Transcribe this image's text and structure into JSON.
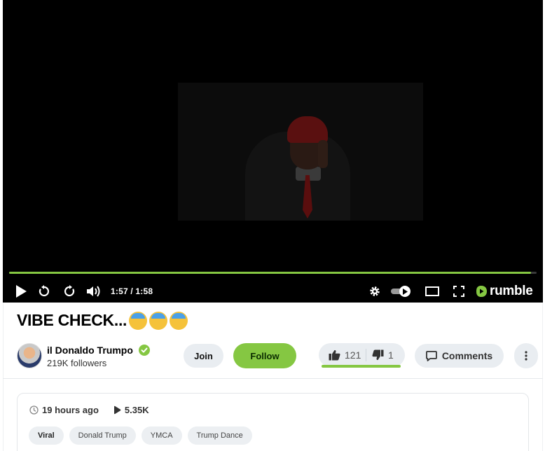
{
  "player": {
    "time_display": "1:57 / 1:58",
    "progress_fraction": 0.99,
    "logo_text": "rumble",
    "accent_color": "#85c742"
  },
  "video": {
    "title": "VIBE CHECK...",
    "title_emojis": [
      "smiling-face-with-hat-emoji",
      "smiling-face-with-hat-emoji",
      "smiling-face-with-hat-emoji"
    ]
  },
  "channel": {
    "name": "il Donaldo Trumpo",
    "followers": "219K followers",
    "verified": true
  },
  "actions": {
    "join_label": "Join",
    "follow_label": "Follow",
    "upvotes": "121",
    "downvotes": "1",
    "vote_ratio": 0.99,
    "comments_label": "Comments"
  },
  "info": {
    "posted": "19 hours ago",
    "views": "5.35K",
    "tags": [
      "Viral",
      "Donald Trump",
      "YMCA",
      "Trump Dance"
    ]
  }
}
